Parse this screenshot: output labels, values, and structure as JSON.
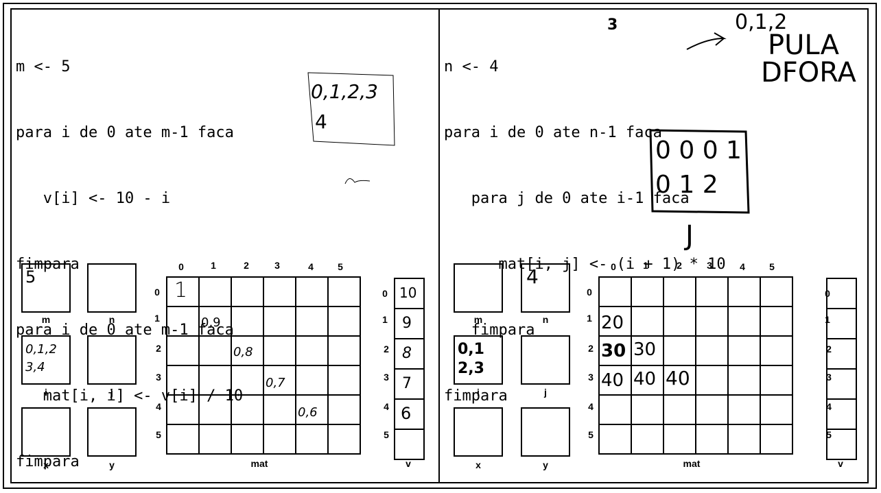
{
  "left": {
    "code": [
      "m <- 5",
      "para i de 0 ate m-1 faca",
      "   v[i] <- 10 - i",
      "fimpara",
      "para i de 0 ate m-1 faca",
      "   mat[i, i] <- v[i] / 10",
      "fimpara"
    ],
    "labels": {
      "m": "m",
      "n": "n",
      "i": "i",
      "j": "j",
      "x": "x",
      "y": "y",
      "mat": "mat",
      "v": "v"
    },
    "col_headers": [
      "0",
      "1",
      "2",
      "3",
      "4",
      "5"
    ],
    "row_headers": [
      "0",
      "1",
      "2",
      "3",
      "4",
      "5"
    ],
    "v_headers": [
      "0",
      "1",
      "2",
      "3",
      "4",
      "5"
    ],
    "handwritten": {
      "m": "5",
      "i_line1": "0,1,2",
      "i_line2": "3,4",
      "note_line1": "0,1,2,3",
      "note_line2": "4",
      "mat_0_0": "1",
      "mat_1_1": "0,9",
      "mat_2_2": "0,8",
      "mat_3_3": "0,7",
      "mat_4_4": "0,6",
      "v0": "10",
      "v1": "9",
      "v2": "8",
      "v3": "7",
      "v4": "6"
    }
  },
  "right": {
    "code": [
      "n <- 4",
      "para i de 0 ate n-1 faca",
      "   para j de 0 ate i-1 faca",
      "      mat[i, j] <- (i + 1) * 10",
      "   fimpara",
      "fimpara"
    ],
    "labels": {
      "m": "m",
      "n": "n",
      "i": "i",
      "j": "j",
      "x": "x",
      "y": "y",
      "mat": "mat",
      "v": "v"
    },
    "col_headers": [
      "0",
      "1",
      "2",
      "3",
      "4",
      "5"
    ],
    "row_headers": [
      "0",
      "1",
      "2",
      "3",
      "4",
      "5"
    ],
    "v_headers": [
      "0",
      "1",
      "2",
      "3",
      "4",
      "5"
    ],
    "handwritten": {
      "three": "3",
      "note_top_line1": "0,1,2",
      "note_top_line2": "PULA",
      "note_top_line3": "DFORA",
      "box_line1": "0 0 0 1",
      "box_line2": "0 1 2",
      "j_letter": "J",
      "n": "4",
      "i_line1": "0,1",
      "i_line2": "2,3",
      "mat_1_0": "20",
      "mat_2_0": "30",
      "mat_2_1": "30",
      "mat_3_0": "40",
      "mat_3_1": "40",
      "mat_3_2": "40"
    }
  }
}
